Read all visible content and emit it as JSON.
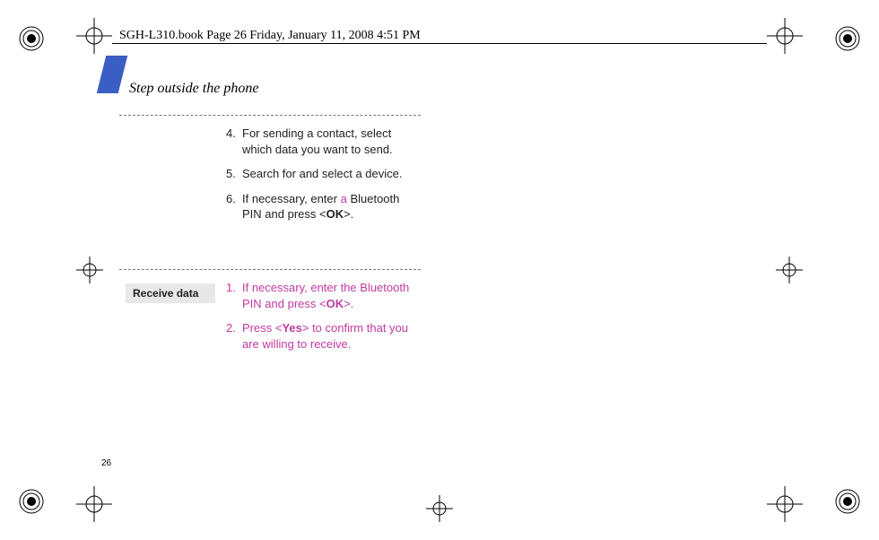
{
  "header": "SGH-L310.book  Page 26  Friday, January 11, 2008  4:51 PM",
  "section_title": "Step outside the phone",
  "page_number": "26",
  "side_label": "Receive data",
  "block1": {
    "s4_num": "4.",
    "s4_text": "For sending a contact, select which data you want to send.",
    "s5_num": "5.",
    "s5_text": "Search for and select a device.",
    "s6_num": "6.",
    "s6_pre": "If necessary, enter ",
    "s6_accent": "a",
    "s6_mid": " Bluetooth PIN and press <",
    "s6_bold": "OK",
    "s6_post": ">."
  },
  "block2": {
    "s1_num": "1.",
    "s1_pre": "If necessary, enter the Bluetooth PIN and press <",
    "s1_bold": "OK",
    "s1_post": ">.",
    "s2_num": "2.",
    "s2_pre": "Press <",
    "s2_bold": "Yes",
    "s2_post": "> to confirm that you are willing to receive."
  }
}
